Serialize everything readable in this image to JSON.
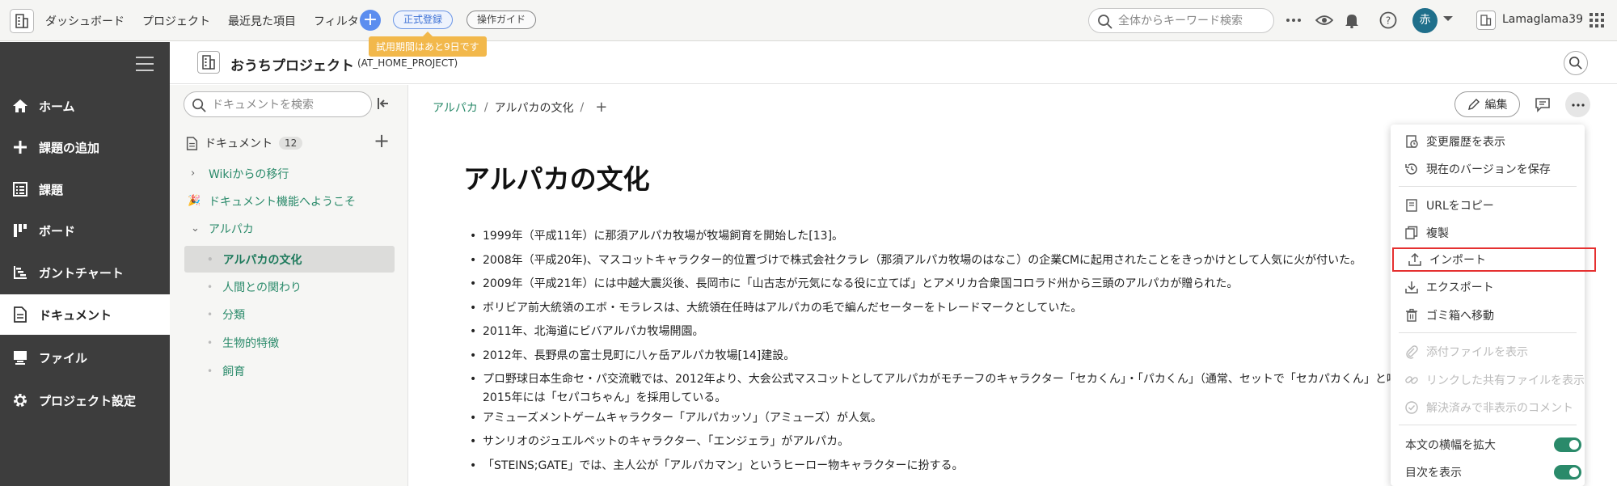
{
  "topbar": {
    "nav": [
      "ダッシュボード",
      "プロジェクト",
      "最近見た項目",
      "フィルタ"
    ],
    "register_label": "正式登録",
    "guide_label": "操作ガイド",
    "trial_notice": "試用期間はあと9日です",
    "search_placeholder": "全体からキーワード検索",
    "avatar_initial": "赤",
    "space_name": "Lamaglama39"
  },
  "sidebar": {
    "items": [
      {
        "label": "ホーム",
        "icon": "home-icon"
      },
      {
        "label": "課題の追加",
        "icon": "plus-icon"
      },
      {
        "label": "課題",
        "icon": "list-icon"
      },
      {
        "label": "ボード",
        "icon": "board-icon"
      },
      {
        "label": "ガントチャート",
        "icon": "gantt-icon"
      },
      {
        "label": "ドキュメント",
        "icon": "document-icon",
        "active": true
      },
      {
        "label": "ファイル",
        "icon": "file-icon"
      },
      {
        "label": "プロジェクト設定",
        "icon": "gear-icon"
      }
    ]
  },
  "project": {
    "title": "おうちプロジェクト",
    "key": "(AT_HOME_PROJECT)"
  },
  "docpanel": {
    "search_placeholder": "ドキュメントを検索",
    "heading": "ドキュメント",
    "count": "12",
    "tree": [
      {
        "label": "Wikiからの移行",
        "level": 0,
        "arrow": "›"
      },
      {
        "label": "ドキュメント機能へようこそ",
        "level": 0,
        "emoji": "🎉"
      },
      {
        "label": "アルパカ",
        "level": 0,
        "arrow": "⌄"
      },
      {
        "label": "アルパカの文化",
        "level": 1,
        "selected": true
      },
      {
        "label": "人間との関わり",
        "level": 1
      },
      {
        "label": "分類",
        "level": 1
      },
      {
        "label": "生物的特徴",
        "level": 1
      },
      {
        "label": "飼育",
        "level": 1
      }
    ]
  },
  "main": {
    "breadcrumb": [
      "アルパカ",
      "アルパカの文化"
    ],
    "edit_label": "編集",
    "title": "アルパカの文化",
    "bullets": [
      "1999年（平成11年）に那須アルパカ牧場が牧場飼育を開始した[13]。",
      "2008年（平成20年)、マスコットキャラクター的位置づけで株式会社クラレ（那須アルパカ牧場のはなこ）の企業CMに起用されたことをきっかけとして人気に火が付いた。",
      "2009年（平成21年）には中越大震災後、長岡市に「山古志が元気になる役に立てば」とアメリカ合衆国コロラド州から三頭のアルパカが贈られた。",
      "ボリビア前大統領のエボ・モラレスは、大統領在任時はアルパカの毛で編んだセーターをトレードマークとしていた。",
      "2011年、北海道にビバアルパカ牧場開園。",
      "2012年、長野県の富士見町に八ヶ岳アルパカ牧場[14]建設。",
      "プロ野球日本生命セ・パ交流戦では、2012年より、大会公式マスコットとしてアルパカがモチーフのキャラクター「セカくん」・「パカくん」（通常、セットで「セカパカくん」と呼称される。",
      "アミューズメントゲームキャラクター「アルパカッソ」（アミューズ）が人気。",
      "サンリオのジュエルペットのキャラクター、「エンジェラ」がアルパカ。",
      "「STEINS;GATE」では、主人公が「アルパカマン」というヒーロー物キャラクターに扮する。"
    ],
    "bullet_continuation": "2015年には「セパコちゃん」を採用している。"
  },
  "menu": {
    "items": [
      {
        "label": "変更履歴を表示",
        "icon": "history-icon"
      },
      {
        "label": "現在のバージョンを保存",
        "icon": "save-version-icon"
      },
      {
        "label": "URLをコピー",
        "icon": "copy-url-icon"
      },
      {
        "label": "複製",
        "icon": "duplicate-icon"
      },
      {
        "label": "インポート",
        "icon": "import-icon",
        "highlighted": true
      },
      {
        "label": "エクスポート",
        "icon": "export-icon"
      },
      {
        "label": "ゴミ箱へ移動",
        "icon": "trash-icon"
      },
      {
        "label": "添付ファイルを表示",
        "icon": "attachment-icon",
        "disabled": true
      },
      {
        "label": "リンクした共有ファイルを表示",
        "icon": "link-icon",
        "disabled": true
      },
      {
        "label": "解決済みで非表示のコメント",
        "icon": "check-circle-icon",
        "disabled": true
      }
    ],
    "toggles": [
      {
        "label": "本文の横幅を拡大",
        "on": true
      },
      {
        "label": "目次を表示",
        "on": true
      }
    ]
  },
  "colors": {
    "accent_green": "#2a8a6a",
    "sidebar_bg": "#3d3d3d",
    "trial_orange": "#f2b84b",
    "highlight_red": "#e53030",
    "avatar_bg": "#1f6f8b"
  }
}
